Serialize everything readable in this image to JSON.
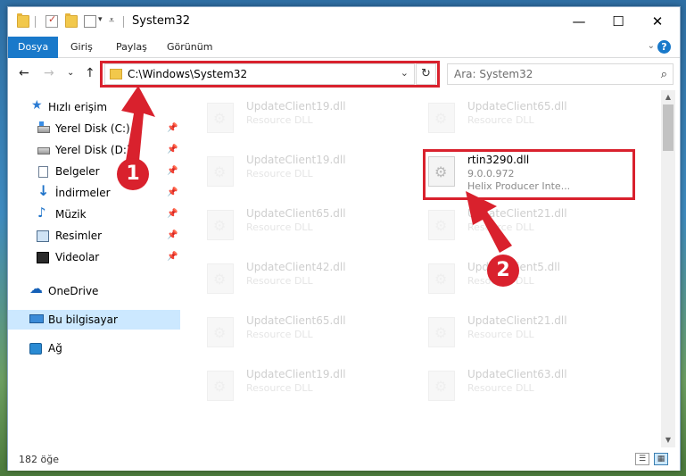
{
  "window": {
    "title": "System32",
    "minimize_glyph": "—",
    "maximize_glyph": "☐",
    "close_glyph": "✕"
  },
  "ribbon": {
    "tabs": [
      {
        "label": "Dosya",
        "active": true
      },
      {
        "label": "Giriş",
        "active": false
      },
      {
        "label": "Paylaş",
        "active": false
      },
      {
        "label": "Görünüm",
        "active": false
      }
    ],
    "expand_glyph": "⌄",
    "help_glyph": "?"
  },
  "nav": {
    "back_glyph": "←",
    "forward_glyph": "→",
    "recent_glyph": "⌄",
    "up_glyph": "↑",
    "address_path": "C:\\Windows\\System32",
    "address_chevron": "⌄",
    "refresh_glyph": "↻",
    "search_placeholder": "Ara: System32",
    "search_glyph": "⌕"
  },
  "sidebar": {
    "quick_access": "Hızlı erişim",
    "items": [
      {
        "label": "Yerel Disk (C:)",
        "icon": "drive-c-icon",
        "pinned": true
      },
      {
        "label": "Yerel Disk (D:)",
        "icon": "drive-d-icon",
        "pinned": true
      },
      {
        "label": "Belgeler",
        "icon": "documents-icon",
        "pinned": true
      },
      {
        "label": "İndirmeler",
        "icon": "downloads-icon",
        "pinned": true
      },
      {
        "label": "Müzik",
        "icon": "music-icon",
        "pinned": true
      },
      {
        "label": "Resimler",
        "icon": "pictures-icon",
        "pinned": true
      },
      {
        "label": "Videolar",
        "icon": "videos-icon",
        "pinned": true
      }
    ],
    "onedrive": "OneDrive",
    "this_pc": "Bu bilgisayar",
    "network": "Ağ",
    "pin_glyph": "✎"
  },
  "files": {
    "left_column": [
      {
        "name": "UpdateClient19.dll",
        "type": "Resource DLL"
      },
      {
        "name": "UpdateClient19.dll",
        "type": "Resource DLL"
      },
      {
        "name": "UpdateClient65.dll",
        "type": "Resource DLL"
      },
      {
        "name": "UpdateClient42.dll",
        "type": "Resource DLL"
      },
      {
        "name": "UpdateClient65.dll",
        "type": "Resource DLL"
      },
      {
        "name": "UpdateClient19.dll",
        "type": "Resource DLL"
      }
    ],
    "right_column": [
      {
        "name": "UpdateClient65.dll",
        "type": "Resource DLL"
      },
      {
        "name": "UpdateClient21.dll",
        "type": "Resource DLL"
      },
      {
        "name": "UpdateClient5.dll",
        "type": "Resource DLL"
      },
      {
        "name": "UpdateClient21.dll",
        "type": "Resource DLL"
      },
      {
        "name": "UpdateClient63.dll",
        "type": "Resource DLL"
      }
    ],
    "highlighted": {
      "name": "rtin3290.dll",
      "version": "9.0.0.972",
      "description": "Helix Producer Inte..."
    }
  },
  "status": {
    "item_count": "182 öğe"
  },
  "annotations": {
    "marker_1": "1",
    "marker_2": "2",
    "color": "#d9212d"
  },
  "colors": {
    "accent": "#1979ca",
    "selection": "#cce8ff",
    "highlight": "#d9212d"
  }
}
